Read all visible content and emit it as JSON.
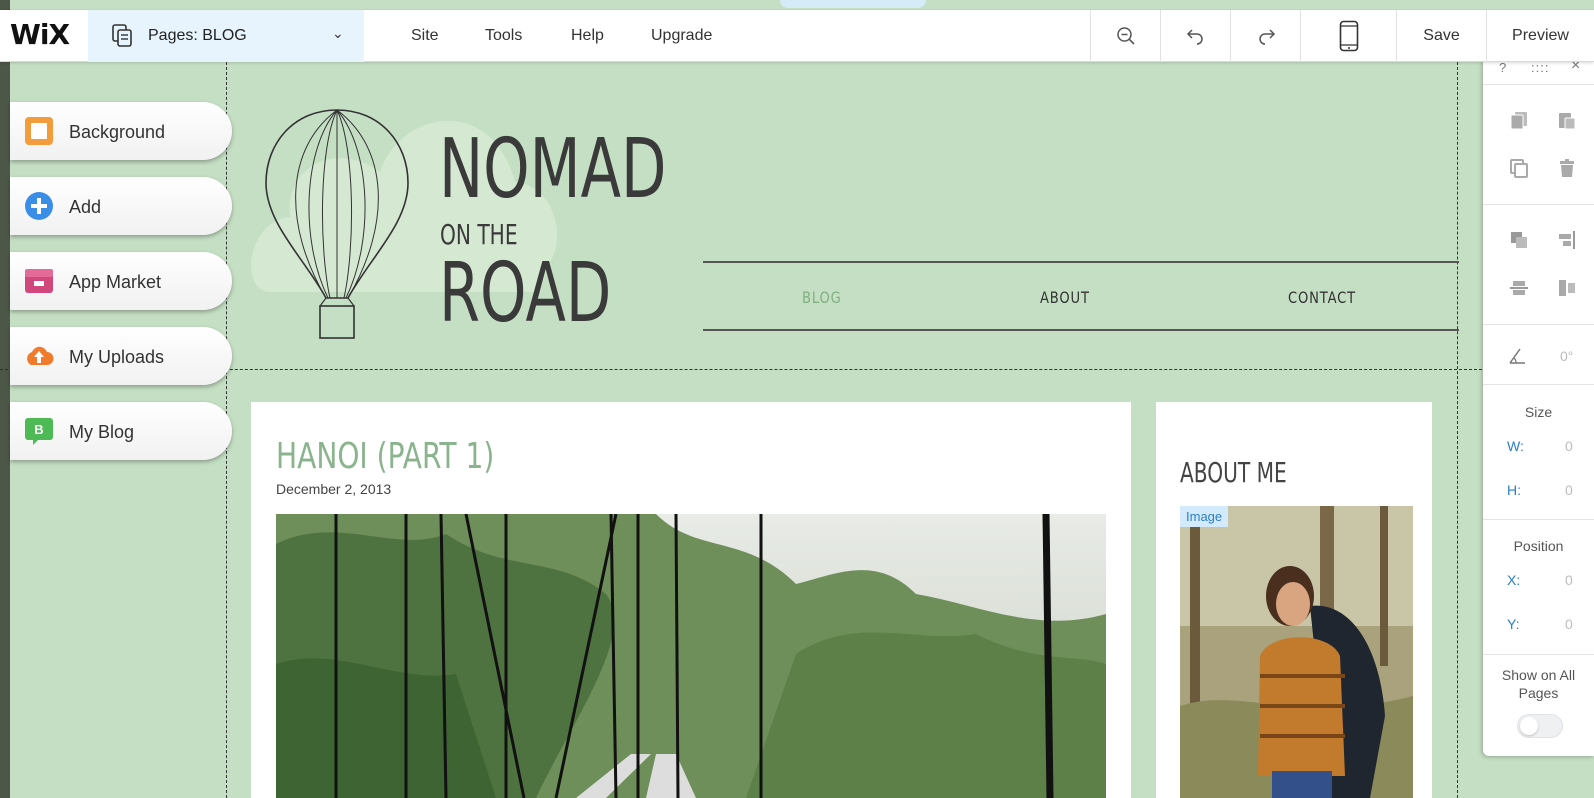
{
  "topbar": {
    "logo": "WiX",
    "pages_label": "Pages: BLOG",
    "menu": [
      "Site",
      "Tools",
      "Help",
      "Upgrade"
    ],
    "save_label": "Save",
    "preview_label": "Preview"
  },
  "left_panel": {
    "items": [
      {
        "label": "Background",
        "icon": "background-icon",
        "color": "#f39c3c"
      },
      {
        "label": "Add",
        "icon": "add-icon",
        "color": "#3b8ee8"
      },
      {
        "label": "App Market",
        "icon": "app-market-icon",
        "color": "#d1487c"
      },
      {
        "label": "My Uploads",
        "icon": "upload-icon",
        "color": "#f07b2c"
      },
      {
        "label": "My Blog",
        "icon": "blog-icon",
        "color": "#4dba56"
      }
    ]
  },
  "site": {
    "title_line1": "NOMAD",
    "title_line2": "ON THE",
    "title_line3": "ROAD",
    "nav": [
      "BLOG",
      "ABOUT",
      "CONTACT"
    ],
    "nav_active_color": "#7fb07f",
    "post": {
      "title": "HANOI (PART 1)",
      "date": "December 2, 2013"
    },
    "about": {
      "title": "ABOUT ME",
      "image_tag": "Image"
    }
  },
  "tool_panel": {
    "help": "?",
    "close": "×",
    "angle_value": "0°",
    "size_title": "Size",
    "w_label": "W:",
    "w_value": "0",
    "h_label": "H:",
    "h_value": "0",
    "position_title": "Position",
    "x_label": "X:",
    "x_value": "0",
    "y_label": "Y:",
    "y_value": "0",
    "show_all_pages": "Show on All Pages"
  }
}
